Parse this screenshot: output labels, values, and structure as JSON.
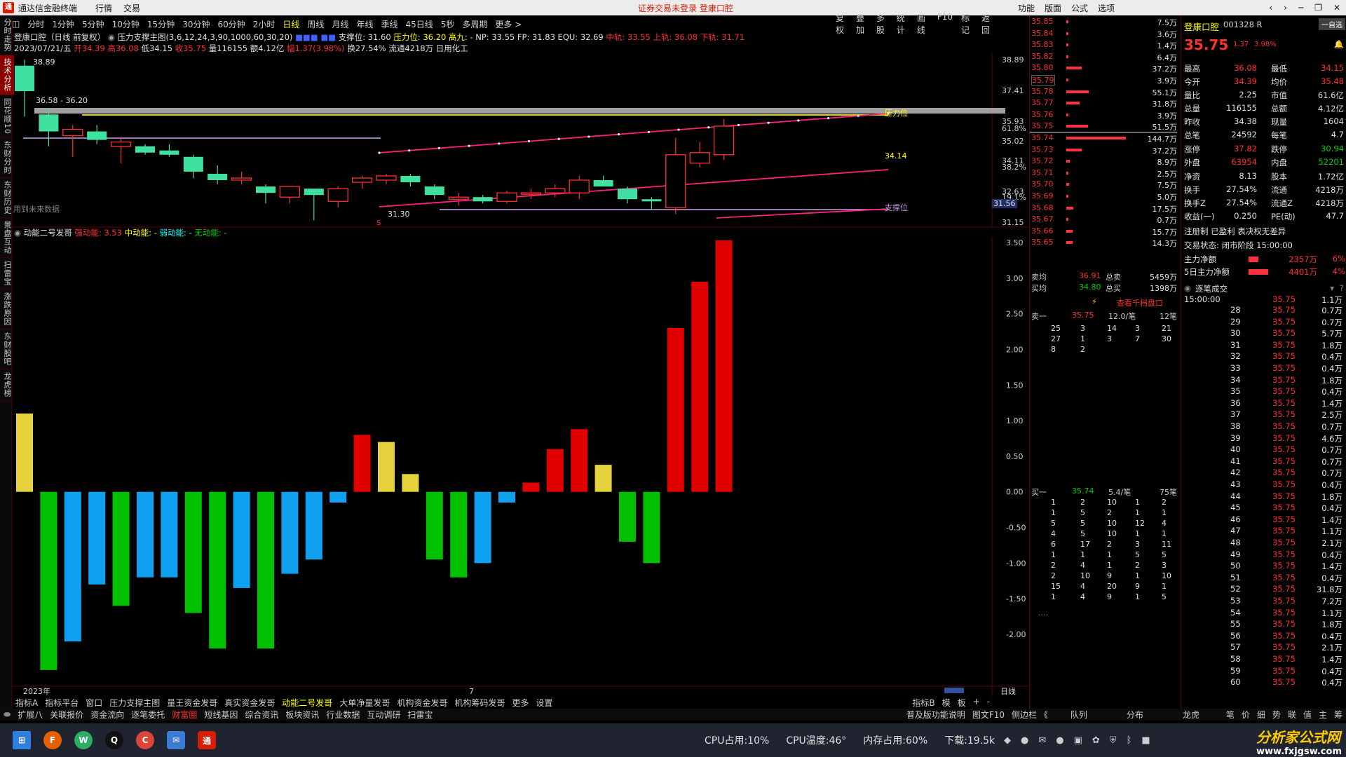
{
  "titlebar": {
    "app_name": "通达信金融终端",
    "menus": [
      "行情",
      "交易"
    ],
    "center_notice": "证券交易未登录  登康口腔",
    "right_menus": [
      "功能",
      "版面",
      "公式",
      "选项"
    ]
  },
  "left_sidebar": [
    "分时走势",
    "技术分析",
    "同花顺10",
    "东财分时",
    "东财历史",
    "景盘互动",
    "扫雷宝",
    "涨跌原因",
    "东财股吧",
    "龙虎榜"
  ],
  "periods": [
    "分时",
    "1分钟",
    "5分钟",
    "10分钟",
    "15分钟",
    "30分钟",
    "60分钟",
    "2小时",
    "日线",
    "周线",
    "月线",
    "年线",
    "季线",
    "45日线",
    "5秒",
    "多周期",
    "更多 >"
  ],
  "active_period": "日线",
  "toolbar_right": [
    "复权",
    "叠加",
    "多股",
    "统计",
    "画线",
    "F10",
    "标记",
    "返回"
  ],
  "header": {
    "name_line": "登康口腔（日线 前复权）",
    "indicator": "压力支撑主图(3,6,12,24,3,90,1000,60,30,20)",
    "support": "支撑位: 31.60",
    "pressure": "压力位: 36.20",
    "high9": "高九:",
    "np": "- NP: 33.55 FP: 31.83 EQU: 32.69",
    "mid": "中轨: 33.55",
    "upper": "上轨: 36.08",
    "lower": "下轨: 31.71",
    "ohlc_date": "2023/07/21/五",
    "ohlc_open": "开34.39",
    "ohlc_high": "高36.08",
    "ohlc_low": "低34.15",
    "ohlc_close": "收35.75",
    "ohlc_rest": "量116155 额4.12亿",
    "ohlc_amp": "幅1.37(3.98%)",
    "ohlc_turn": "换27.54% 流通4218万 日用化工"
  },
  "price_chart": {
    "y_labels": [
      "38.89",
      "37.41",
      "35.93",
      "35.02",
      "34.11",
      "32.63",
      "31.15"
    ],
    "y_labels_extra": [
      "61.8%",
      "38.2%",
      "19.1%"
    ],
    "current_price_tag": "31.56",
    "annot_high": "38.89",
    "annot_range": "36.58 - 36.20",
    "annot_low": "31.30",
    "annot_last": "34.14",
    "pressure_label": "压力位",
    "support_label": "支撑位",
    "future_note": "用到未来数据",
    "candles": [
      {
        "o": 37.4,
        "h": 38.89,
        "l": 36.2,
        "c": 38.6,
        "color": "green"
      },
      {
        "o": 35.5,
        "h": 36.6,
        "l": 34.8,
        "c": 36.3,
        "color": "green"
      },
      {
        "o": 35.6,
        "h": 35.8,
        "l": 34.3,
        "c": 35.3,
        "color": "red"
      },
      {
        "o": 35.1,
        "h": 35.8,
        "l": 34.9,
        "c": 35.5,
        "color": "green"
      },
      {
        "o": 35.0,
        "h": 35.2,
        "l": 34.0,
        "c": 34.8,
        "color": "red"
      },
      {
        "o": 34.8,
        "h": 34.9,
        "l": 34.4,
        "c": 34.5,
        "color": "green"
      },
      {
        "o": 34.6,
        "h": 34.9,
        "l": 34.3,
        "c": 34.4,
        "color": "green"
      },
      {
        "o": 34.3,
        "h": 34.4,
        "l": 33.3,
        "c": 33.6,
        "color": "green"
      },
      {
        "o": 33.5,
        "h": 33.9,
        "l": 33.0,
        "c": 33.2,
        "color": "green"
      },
      {
        "o": 33.2,
        "h": 33.6,
        "l": 33.0,
        "c": 33.3,
        "color": "red"
      },
      {
        "o": 32.9,
        "h": 33.0,
        "l": 32.1,
        "c": 32.6,
        "color": "green"
      },
      {
        "o": 32.4,
        "h": 32.9,
        "l": 32.1,
        "c": 32.9,
        "color": "red"
      },
      {
        "o": 32.8,
        "h": 32.8,
        "l": 31.3,
        "c": 32.5,
        "color": "green"
      },
      {
        "o": 32.2,
        "h": 32.9,
        "l": 31.9,
        "c": 32.8,
        "color": "red"
      },
      {
        "o": 33.1,
        "h": 33.4,
        "l": 32.8,
        "c": 33.3,
        "color": "red"
      },
      {
        "o": 33.2,
        "h": 33.5,
        "l": 33.0,
        "c": 33.4,
        "color": "red"
      },
      {
        "o": 33.4,
        "h": 33.5,
        "l": 32.9,
        "c": 33.1,
        "color": "green"
      },
      {
        "o": 32.9,
        "h": 33.0,
        "l": 32.3,
        "c": 32.5,
        "color": "green"
      },
      {
        "o": 32.3,
        "h": 32.6,
        "l": 32.0,
        "c": 32.4,
        "color": "red"
      },
      {
        "o": 32.4,
        "h": 32.5,
        "l": 32.1,
        "c": 32.2,
        "color": "green"
      },
      {
        "o": 32.2,
        "h": 32.7,
        "l": 32.1,
        "c": 32.6,
        "color": "red"
      },
      {
        "o": 32.6,
        "h": 32.8,
        "l": 32.3,
        "c": 32.6,
        "color": "red"
      },
      {
        "o": 32.6,
        "h": 33.0,
        "l": 32.4,
        "c": 32.8,
        "color": "red"
      },
      {
        "o": 32.6,
        "h": 33.4,
        "l": 32.3,
        "c": 33.2,
        "color": "red"
      },
      {
        "o": 33.2,
        "h": 33.4,
        "l": 32.9,
        "c": 32.9,
        "color": "green"
      },
      {
        "o": 32.8,
        "h": 32.9,
        "l": 32.1,
        "c": 32.3,
        "color": "green"
      },
      {
        "o": 32.3,
        "h": 32.4,
        "l": 31.8,
        "c": 32.2,
        "color": "green"
      },
      {
        "o": 31.9,
        "h": 35.2,
        "l": 31.6,
        "c": 34.4,
        "color": "red"
      },
      {
        "o": 34.0,
        "h": 35.0,
        "l": 33.8,
        "c": 34.5,
        "color": "red"
      },
      {
        "o": 34.4,
        "h": 36.08,
        "l": 34.15,
        "c": 35.75,
        "color": "red"
      }
    ]
  },
  "energy_panel": {
    "title": "动能二号发哥",
    "strong_label": "强动能:",
    "strong_value": "3.53",
    "mid_label": "中动能:",
    "mid_value": "-",
    "weak_label": "弱动能:",
    "weak_value": "-",
    "none_label": "无动能:",
    "none_value": "-",
    "y_labels": [
      "3.50",
      "3.00",
      "2.50",
      "2.00",
      "1.50",
      "1.00",
      "0.50",
      "0.00",
      "-0.50",
      "-1.00",
      "-1.50",
      "-2.00"
    ],
    "x_labels": [
      "2023年",
      "7"
    ],
    "period_tag": "日线"
  },
  "chart_data": {
    "type": "bar",
    "title": "动能二号发哥",
    "ylim": [
      -2.5,
      3.6
    ],
    "x": [
      "2023年",
      "7"
    ],
    "values": [
      1.1,
      -2.5,
      -2.1,
      -1.3,
      -1.6,
      -1.2,
      -1.2,
      -1.7,
      -2.2,
      -1.35,
      -2.2,
      -1.15,
      -0.95,
      -0.15,
      0.8,
      0.7,
      0.25,
      -0.95,
      -1.2,
      -1.0,
      -0.15,
      0.13,
      0.6,
      0.88,
      0.38,
      -0.7,
      -1.0,
      2.3,
      2.95,
      3.53
    ],
    "colors": [
      "yellow",
      "green",
      "blue",
      "blue",
      "green",
      "blue",
      "blue",
      "green",
      "green",
      "blue",
      "green",
      "blue",
      "blue",
      "blue",
      "red",
      "yellow",
      "yellow",
      "green",
      "green",
      "blue",
      "blue",
      "red",
      "red",
      "red",
      "yellow",
      "green",
      "green",
      "red",
      "red",
      "red"
    ]
  },
  "bottom_tabs": [
    "指标A",
    "指标平台",
    "窗口",
    "压力支撑主图",
    "量王资金发哥",
    "真实资金发哥",
    "动能二号发哥",
    "大单净量发哥",
    "机构资金发哥",
    "机构筹码发哥",
    "更多",
    "设置"
  ],
  "bottom_tabs_active": "动能二号发哥",
  "bottom_tabs_right": [
    "指标B",
    "模",
    "板",
    "+",
    "-"
  ],
  "bottom_tabs2": [
    "扩展八",
    "关联报价",
    "资金流向",
    "逐笔委托",
    "财富圈",
    "短线基因",
    "综合资讯",
    "板块资讯",
    "行业数据",
    "互动调研",
    "扫雷宝"
  ],
  "bottom_tabs2_active": "财富圈",
  "bottom_tabs2_right": [
    "普及版功能说明",
    "图文F10",
    "侧边栏 《",
    "队列",
    "分布",
    "龙虎",
    "笔",
    "价",
    "细",
    "势",
    "联",
    "值",
    "主",
    "筹"
  ],
  "orderbook": {
    "levels": [
      {
        "price": "35.85",
        "vol": "7.5万",
        "bar": 0.03
      },
      {
        "price": "35.84",
        "vol": "3.6万",
        "bar": 0.03
      },
      {
        "price": "35.83",
        "vol": "1.4万",
        "bar": 0.02
      },
      {
        "price": "35.82",
        "vol": "6.4万",
        "bar": 0.03
      },
      {
        "price": "35.80",
        "vol": "37.2万",
        "bar": 0.26
      },
      {
        "price": "35.79",
        "vol": "3.9万",
        "bar": 0.03
      },
      {
        "price": "35.78",
        "vol": "55.1万",
        "bar": 0.38
      },
      {
        "price": "35.77",
        "vol": "31.8万",
        "bar": 0.22
      },
      {
        "price": "35.76",
        "vol": "3.9万",
        "bar": 0.03
      },
      {
        "price": "35.75",
        "vol": "51.5万",
        "bar": 0.36
      },
      {
        "price": "35.74",
        "vol": "144.7万",
        "bar": 1.0
      },
      {
        "price": "35.73",
        "vol": "37.2万",
        "bar": 0.26
      },
      {
        "price": "35.72",
        "vol": "8.9万",
        "bar": 0.06
      },
      {
        "price": "35.71",
        "vol": "2.5万",
        "bar": 0.03
      },
      {
        "price": "35.70",
        "vol": "7.5万",
        "bar": 0.05
      },
      {
        "price": "35.69",
        "vol": "5.0万",
        "bar": 0.04
      },
      {
        "price": "35.68",
        "vol": "17.5万",
        "bar": 0.12
      },
      {
        "price": "35.67",
        "vol": "0.7万",
        "bar": 0.01
      },
      {
        "price": "35.66",
        "vol": "15.7万",
        "bar": 0.11
      },
      {
        "price": "35.65",
        "vol": "14.3万",
        "bar": 0.1
      }
    ],
    "sell_avg_label": "卖均",
    "sell_avg": "36.91",
    "total_sell_label": "总卖",
    "total_sell": "5459万",
    "buy_avg_label": "买均",
    "buy_avg": "34.80",
    "total_buy_label": "总买",
    "total_buy": "1398万",
    "view_thousand": "查看千档盘口",
    "sell1_label": "卖一",
    "sell1_price": "35.75",
    "sell1_per": "12.0/笔",
    "sell1_count": "12笔",
    "sell_queue": [
      [
        "25",
        "3",
        "14",
        "3",
        "21"
      ],
      [
        "27",
        "1",
        "3",
        "7",
        "30"
      ],
      [
        "8",
        "2",
        "",
        "",
        ""
      ]
    ],
    "buy1_label": "买一",
    "buy1_price": "35.74",
    "buy1_per": "5.4/笔",
    "buy1_count": "75笔",
    "buy_queue": [
      [
        "1",
        "2",
        "10",
        "1",
        "2"
      ],
      [
        "1",
        "5",
        "2",
        "1",
        "1"
      ],
      [
        "5",
        "5",
        "10",
        "12",
        "4"
      ],
      [
        "4",
        "5",
        "10",
        "1",
        "1"
      ],
      [
        "6",
        "17",
        "2",
        "3",
        "11"
      ],
      [
        "1",
        "1",
        "1",
        "5",
        "5"
      ],
      [
        "2",
        "4",
        "1",
        "2",
        "3"
      ],
      [
        "2",
        "10",
        "9",
        "1",
        "10"
      ],
      [
        "15",
        "4",
        "20",
        "9",
        "1"
      ],
      [
        "1",
        "4",
        "9",
        "1",
        "5"
      ]
    ],
    "more": "...."
  },
  "quote": {
    "name": "登康口腔",
    "code": "001328 R",
    "price": "35.75",
    "change": "1.37",
    "pct": "3.98%",
    "watch_btn": "一自选",
    "rows": [
      [
        "最高",
        "36.08",
        "最低",
        "34.15"
      ],
      [
        "今开",
        "34.39",
        "均价",
        "35.48"
      ],
      [
        "量比",
        "2.25",
        "市值",
        "61.6亿"
      ],
      [
        "总量",
        "116155",
        "总额",
        "4.12亿"
      ],
      [
        "昨收",
        "34.38",
        "现量",
        "1604"
      ],
      [
        "总笔",
        "24592",
        "每笔",
        "4.7"
      ],
      [
        "涨停",
        "37.82",
        "跌停",
        "30.94"
      ],
      [
        "外盘",
        "63954",
        "内盘",
        "52201"
      ],
      [
        "净资",
        "8.13",
        "股本",
        "1.72亿"
      ],
      [
        "换手",
        "27.54%",
        "流通",
        "4218万"
      ],
      [
        "换手Z",
        "27.54%",
        "流通Z",
        "4218万"
      ],
      [
        "收益(一)",
        "0.250",
        "PE(动)",
        "47.7"
      ]
    ],
    "reg_line": "注册制 已盈利 表决权无差异",
    "trade_status": "交易状态: 闭市阶段 15:00:00",
    "main_net_label": "主力净额",
    "main_net": "2357万",
    "main_net_pct": "6%",
    "main5_label": "5日主力净额",
    "main5": "4401万",
    "main5_pct": "4%",
    "ticks_title": "逐笔成交",
    "tick_start": "15:00:00",
    "ticks": [
      [
        "28",
        "35.75",
        "0.7万"
      ],
      [
        "29",
        "35.75",
        "0.7万"
      ],
      [
        "30",
        "35.75",
        "5.7万"
      ],
      [
        "31",
        "35.75",
        "1.8万"
      ],
      [
        "32",
        "35.75",
        "0.4万"
      ],
      [
        "33",
        "35.75",
        "0.4万"
      ],
      [
        "34",
        "35.75",
        "1.8万"
      ],
      [
        "35",
        "35.75",
        "0.4万"
      ],
      [
        "36",
        "35.75",
        "1.4万"
      ],
      [
        "37",
        "35.75",
        "2.5万"
      ],
      [
        "38",
        "35.75",
        "0.7万"
      ],
      [
        "39",
        "35.75",
        "4.6万"
      ],
      [
        "40",
        "35.75",
        "0.7万"
      ],
      [
        "41",
        "35.75",
        "0.7万"
      ],
      [
        "42",
        "35.75",
        "0.7万"
      ],
      [
        "43",
        "35.75",
        "0.4万"
      ],
      [
        "44",
        "35.75",
        "1.8万"
      ],
      [
        "45",
        "35.75",
        "0.4万"
      ],
      [
        "46",
        "35.75",
        "1.4万"
      ],
      [
        "47",
        "35.75",
        "1.1万"
      ],
      [
        "48",
        "35.75",
        "2.1万"
      ],
      [
        "49",
        "35.75",
        "0.4万"
      ],
      [
        "50",
        "35.75",
        "1.4万"
      ],
      [
        "51",
        "35.75",
        "0.4万"
      ],
      [
        "52",
        "35.75",
        "31.8万"
      ],
      [
        "53",
        "35.75",
        "7.2万"
      ],
      [
        "54",
        "35.75",
        "1.1万"
      ],
      [
        "55",
        "35.75",
        "1.8万"
      ],
      [
        "56",
        "35.75",
        "0.4万"
      ],
      [
        "57",
        "35.75",
        "2.1万"
      ],
      [
        "58",
        "35.75",
        "1.4万"
      ],
      [
        "59",
        "35.75",
        "0.4万"
      ],
      [
        "60",
        "35.75",
        "0.4万"
      ]
    ],
    "first_tick": "1.1万"
  },
  "taskbar": {
    "cpu": "CPU占用:10%",
    "temp": "CPU温度:46°",
    "mem": "内存占用:60%",
    "download": "下载:19.5k"
  },
  "watermark": {
    "main": "分析家公式网",
    "url": "www.fxjgsw.com"
  },
  "colors": {
    "up": "#ff3030",
    "down_candle": "#40e0a0",
    "yellow": "#e6d23c",
    "green_bar": "#00c000",
    "blue_bar": "#10a0f0",
    "red_bar": "#e00000",
    "pressure": "#d8d800",
    "channel": "#ff2080"
  }
}
